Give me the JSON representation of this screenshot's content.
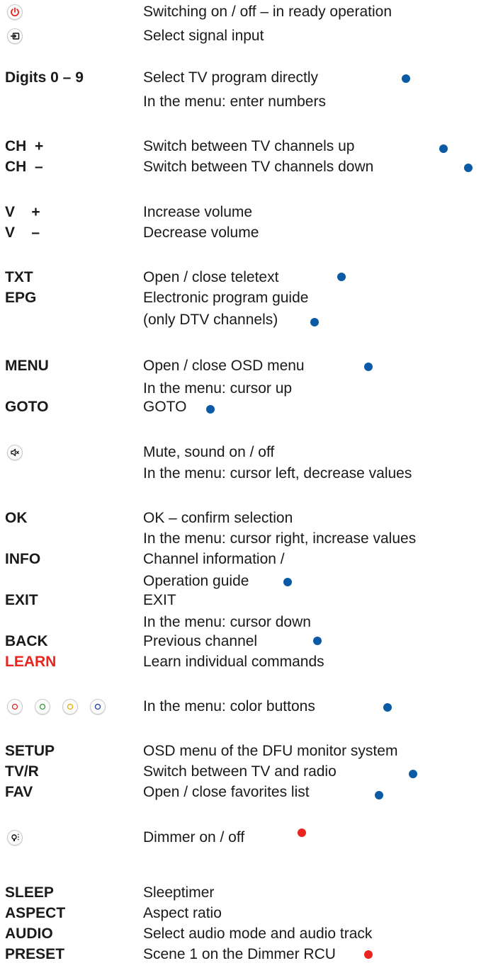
{
  "rows": [
    {
      "key": "",
      "desc": "Switching on / off – in ready operation",
      "icon": "power-icon",
      "dot": "none"
    },
    {
      "key": "",
      "desc": "Select signal input",
      "icon": "signal-input-icon",
      "dot": "none"
    },
    {
      "key": "Digits 0 – 9",
      "desc": "Select TV program directly",
      "dot": "blue"
    },
    {
      "key": "",
      "desc": "In the menu: enter numbers",
      "dot": "none"
    },
    {
      "key": "CH  +",
      "desc": "Switch between TV channels up",
      "dot": "blue"
    },
    {
      "key": "CH  –",
      "desc": "Switch between TV channels down",
      "dot": "blue"
    },
    {
      "key": "V    +",
      "desc": "Increase volume",
      "dot": "none"
    },
    {
      "key": "V    –",
      "desc": "Decrease volume",
      "dot": "none"
    },
    {
      "key": "TXT",
      "desc": "Open / close teletext",
      "dot": "blue"
    },
    {
      "key": "EPG",
      "desc": "Electronic program guide",
      "dot": "none"
    },
    {
      "key": "",
      "desc": "(only DTV channels)",
      "dot": "blue"
    },
    {
      "key": "MENU",
      "desc": "Open / close OSD menu",
      "dot": "blue"
    },
    {
      "key": "",
      "desc": "In the menu: cursor up",
      "dot": "none"
    },
    {
      "key": "GOTO",
      "desc": "GOTO",
      "dot": "blue"
    },
    {
      "key": "",
      "desc": "Mute, sound on / off",
      "icon": "mute-icon",
      "dot": "none"
    },
    {
      "key": "",
      "desc": "In the menu: cursor left, decrease values",
      "dot": "none"
    },
    {
      "key": "OK",
      "desc": "OK – confirm selection",
      "dot": "none"
    },
    {
      "key": "",
      "desc": "In the menu: cursor right, increase values",
      "dot": "none"
    },
    {
      "key": "INFO",
      "desc": "Channel information /",
      "dot": "none"
    },
    {
      "key": "",
      "desc": "Operation guide",
      "dot": "blue"
    },
    {
      "key": "EXIT",
      "desc": "EXIT",
      "dot": "none"
    },
    {
      "key": "",
      "desc": "In the menu: cursor down",
      "dot": "none"
    },
    {
      "key": "BACK",
      "desc": "Previous channel",
      "dot": "blue"
    },
    {
      "key": "LEARN",
      "desc": "Learn individual commands",
      "dot": "none",
      "key_color": "#e8251f"
    },
    {
      "key": "",
      "desc": "In the menu: color buttons",
      "icon": "color-buttons-icon",
      "dot": "blue"
    },
    {
      "key": "SETUP",
      "desc": "OSD menu of the DFU monitor system",
      "dot": "none"
    },
    {
      "key": "TV/R",
      "desc": "Switch between TV and radio",
      "dot": "blue"
    },
    {
      "key": "FAV",
      "desc": "Open / close favorites list",
      "dot": "blue"
    },
    {
      "key": "",
      "desc": "Dimmer on / off",
      "icon": "dimmer-icon",
      "dot": "red"
    },
    {
      "key": "SLEEP",
      "desc": "Sleeptimer",
      "dot": "none"
    },
    {
      "key": "ASPECT",
      "desc": "Aspect ratio",
      "dot": "none"
    },
    {
      "key": "AUDIO",
      "desc": "Select audio mode and audio track",
      "dot": "none"
    },
    {
      "key": "PRESET",
      "desc": "Scene 1 on the Dimmer RCU",
      "dot": "red"
    }
  ],
  "colors": {
    "dot_blue": "#0b5aa5",
    "dot_red": "#e8251f",
    "power_red": "#e8251f",
    "color_button_red": "#e8251f",
    "color_button_green": "#2e9a3a",
    "color_button_yellow": "#e2b000",
    "color_button_blue": "#1d3f9c"
  }
}
